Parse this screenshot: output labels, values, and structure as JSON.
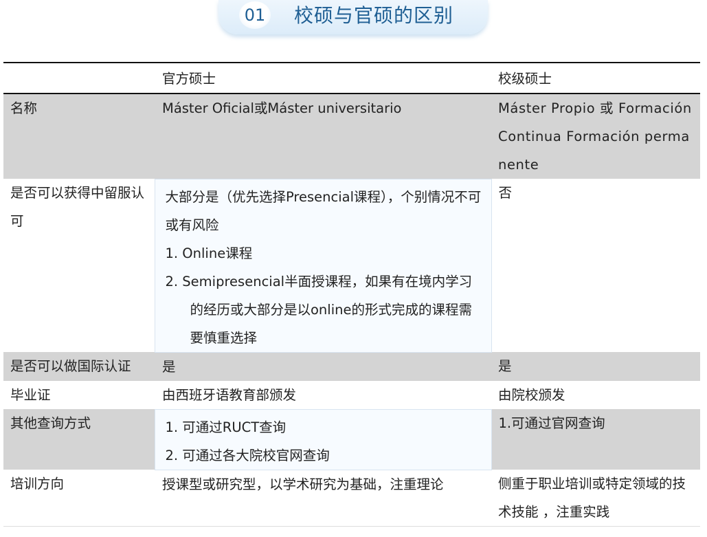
{
  "header": {
    "number": "01",
    "title": "校硕与官硕的区别"
  },
  "table": {
    "columns": [
      "",
      "官方硕士",
      "校级硕士"
    ],
    "rows": {
      "name": {
        "label": "名称",
        "official": "Máster Oficial或Máster  universitario",
        "school": "Máster  Propio 或 Formación  Continua Formación permanente"
      },
      "residence": {
        "label": "是否可以获得中留服认可",
        "official_intro": "大部分是（优先选择Presencial课程），个别情况不可或有风险",
        "official_items": [
          "1.  Online课程",
          "2. Semipresencial半面授课程，如果有在境内学习的经历或大部分是以online的形式完成的课程需要慎重选择"
        ],
        "school": "否"
      },
      "international": {
        "label": "是否可以做国际认证",
        "official": "是",
        "school": "是"
      },
      "diploma": {
        "label": "毕业证",
        "official": "由西班牙语教育部颁发",
        "school": "由院校颁发"
      },
      "verify": {
        "label": "其他查询方式",
        "official_items": [
          "1.  可通过RUCT查询",
          "2.  可通过各大院校官网查询"
        ],
        "school": "1.可通过官网查询"
      },
      "direction": {
        "label": "培训方向",
        "official": "授课型或研究型，以学术研究为基础，注重理论",
        "school": "侧重于职业培训或特定领域的技术技能 ，注重实践"
      }
    }
  },
  "colors": {
    "accent": "#1f5f94",
    "row_grey": "#d4d4d4",
    "highlight_cell": "#f7fbff"
  }
}
